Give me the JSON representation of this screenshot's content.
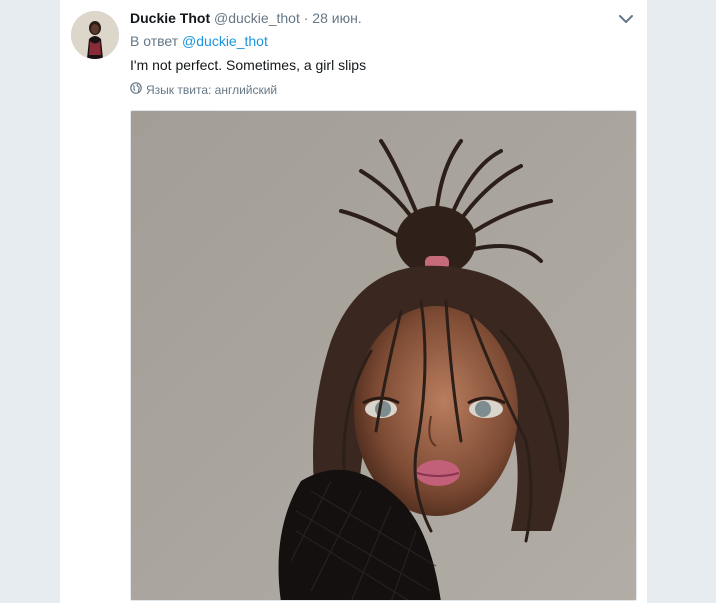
{
  "tweet": {
    "author_name": "Duckie Thot",
    "author_handle": "@duckie_thot",
    "separator": "·",
    "date": "28 июн.",
    "reply_prefix": "В ответ",
    "reply_handle": "@duckie_thot",
    "text": "I'm not perfect. Sometimes, a girl slips",
    "language_label": "Язык твита: английский"
  },
  "icons": {
    "menu": "chevron-down-icon",
    "language": "globe-icon"
  },
  "colors": {
    "page_background": "#e6ecf0",
    "card_background": "#ffffff",
    "link": "#1b95e0",
    "primary_text": "#14171a",
    "secondary_text": "#657786"
  }
}
